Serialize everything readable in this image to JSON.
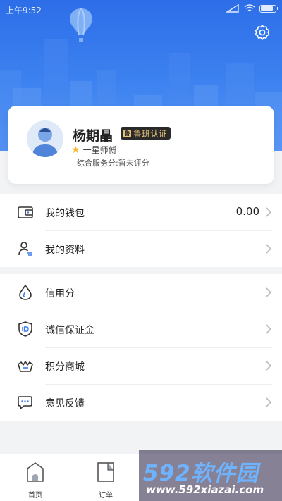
{
  "status_bar": {
    "time": "上午9:52"
  },
  "profile": {
    "name": "杨期晶",
    "badge": "鲁班认证",
    "badge_icon": "鲁",
    "level": "一星师傅",
    "score": "综合服务分:暂未评分"
  },
  "menu_group_1": [
    {
      "label": "我的钱包",
      "value": "0.00",
      "icon": "wallet-icon"
    },
    {
      "label": "我的资料",
      "icon": "user-profile-icon"
    }
  ],
  "menu_group_2": [
    {
      "label": "信用分",
      "icon": "drop-icon"
    },
    {
      "label": "诚信保证金",
      "icon": "shield-icon"
    },
    {
      "label": "积分商城",
      "icon": "crown-basket-icon"
    },
    {
      "label": "意见反馈",
      "icon": "chat-icon"
    }
  ],
  "tabbar": {
    "home": "首页",
    "orders": "订单"
  },
  "watermark": {
    "logo": "592软件园",
    "url": "www.592xiazai.com"
  },
  "colors": {
    "primary": "#2d6ee8",
    "accent": "#f6b521",
    "badge_gold": "#e6c37a"
  }
}
